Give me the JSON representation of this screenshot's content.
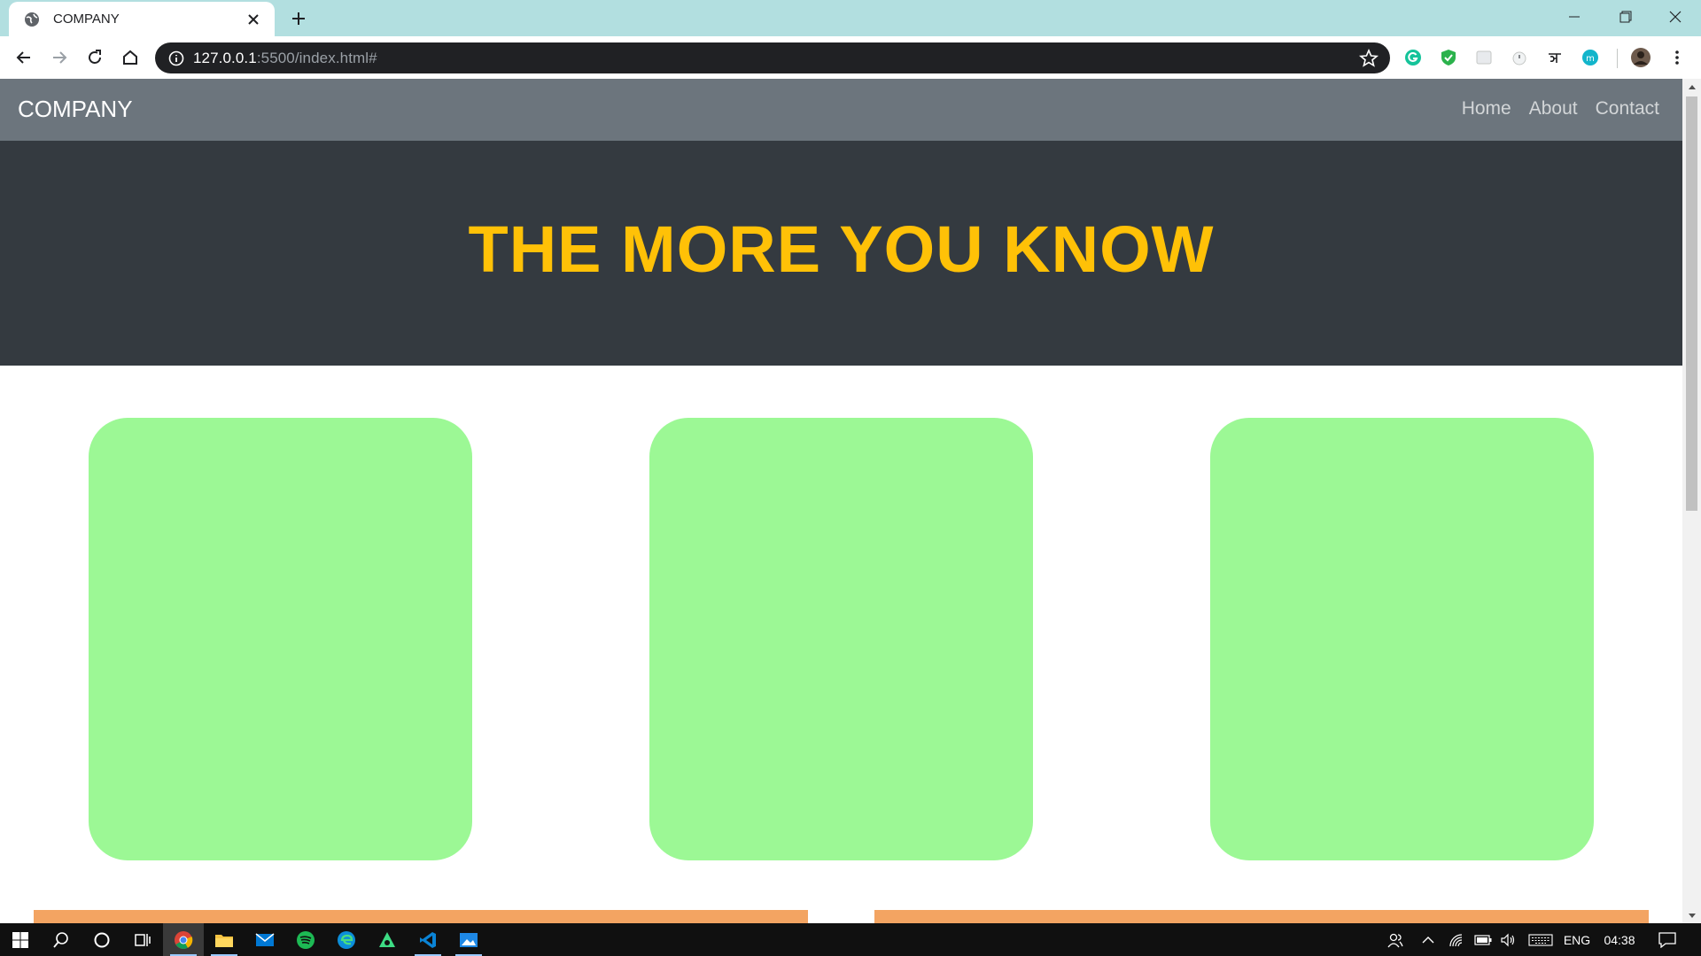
{
  "browser": {
    "tab_title": "COMPANY",
    "url_host": "127.0.0.1",
    "url_rest": ":5500/index.html#"
  },
  "site": {
    "brand": "COMPANY",
    "nav": [
      {
        "label": "Home"
      },
      {
        "label": "About"
      },
      {
        "label": "Contact"
      }
    ],
    "hero_heading": "THE MORE YOU KNOW"
  },
  "colors": {
    "nav_bg": "#6c757d",
    "hero_bg": "#343a40",
    "hero_text": "#ffc107",
    "card_bg": "#9cf895",
    "strip_bg": "#f3a462"
  },
  "taskbar": {
    "apps": [
      "windows-start-icon",
      "search-icon",
      "cortana-icon",
      "task-view-icon",
      "chrome-icon",
      "file-explorer-icon",
      "mail-icon",
      "spotify-icon",
      "edge-icon",
      "android-studio-icon",
      "vscode-icon",
      "photos-icon"
    ],
    "language": "ENG",
    "time": "04:38"
  }
}
